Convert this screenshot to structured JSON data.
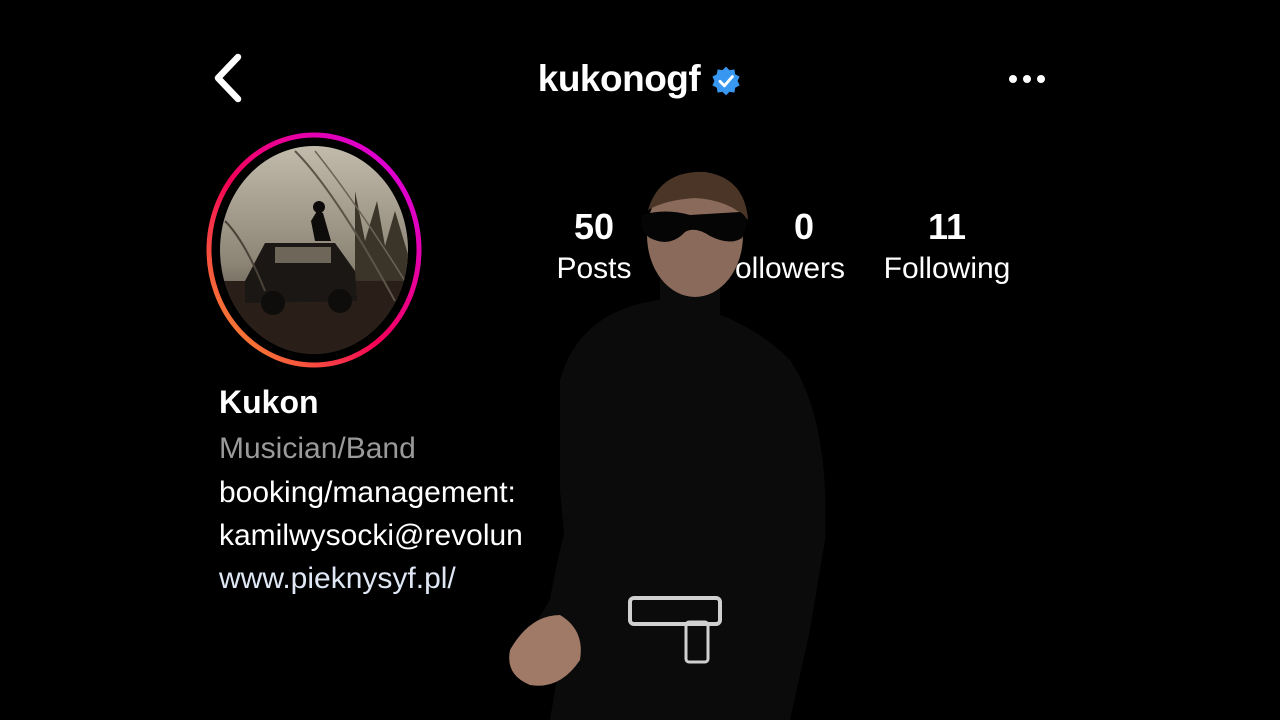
{
  "header": {
    "username": "kukonogf",
    "verified": true,
    "icons": {
      "back": "chevron-left-icon",
      "more": "more-horizontal-icon",
      "verified": "verified-badge-icon"
    }
  },
  "profile": {
    "avatar_description_icon": "avatar-photo",
    "stats": [
      {
        "number": "50",
        "label": "Posts"
      },
      {
        "number": "0",
        "label": "ollowers"
      },
      {
        "number": "11",
        "label": "Following"
      }
    ],
    "display_name": "Kukon",
    "category": "Musician/Band",
    "bio_lines": [
      "booking/management:",
      "kamilwysocki@revolun"
    ],
    "link": "www.pieknysyf.pl/"
  },
  "colors": {
    "background": "#000000",
    "ring_start": "#F9A825",
    "ring_mid": "#F50057",
    "ring_end": "#D500F9",
    "verified_blue": "#3897F0",
    "category_gray": "#9A9A9A"
  }
}
